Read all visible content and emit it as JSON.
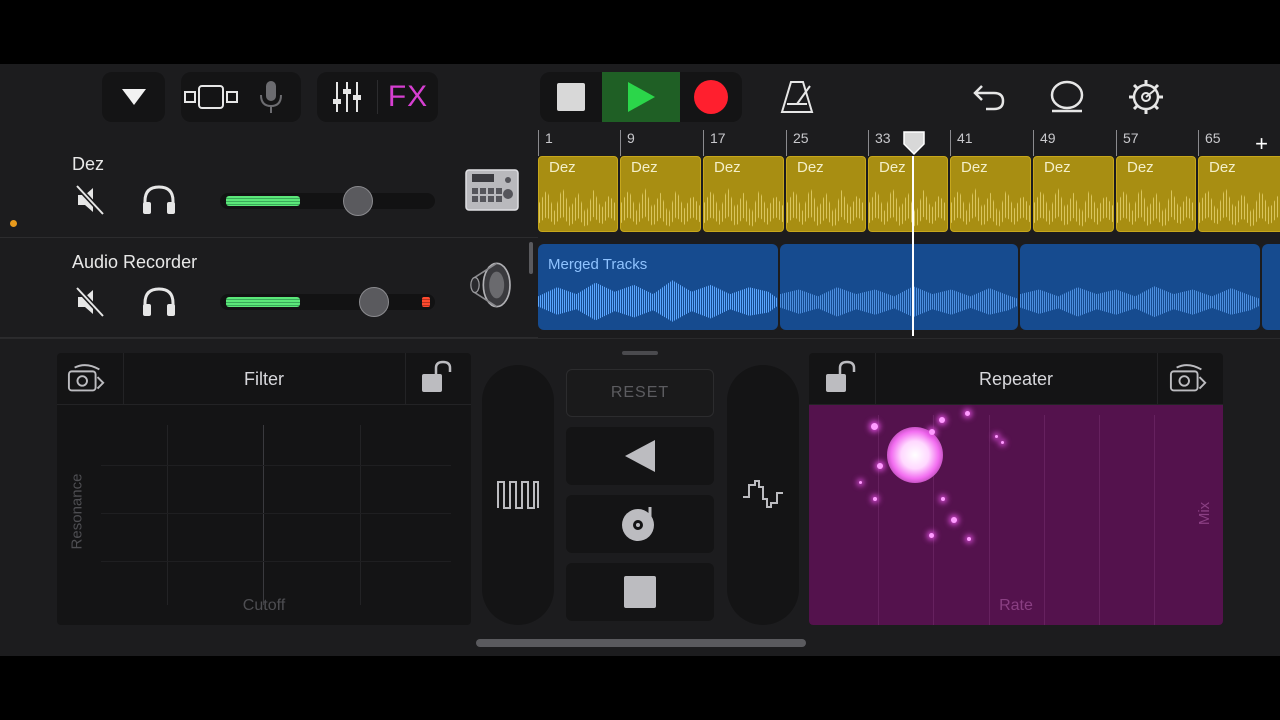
{
  "toolbar": {
    "fx_label": "FX",
    "icons": [
      "dropdown-triangle-icon",
      "track-view-icon",
      "microphone-icon",
      "mixer-sliders-icon",
      "fx",
      "stop-icon",
      "play-icon",
      "record-icon",
      "metronome-icon",
      "undo-icon",
      "loop-icon",
      "settings-gear-icon"
    ]
  },
  "ruler": {
    "bars": [
      "1",
      "9",
      "17",
      "25",
      "33",
      "41",
      "49",
      "57",
      "65"
    ],
    "add_label": "+"
  },
  "tracks": [
    {
      "name": "Dez",
      "muted": true,
      "volume_level": 0.6,
      "instrument_icon": "drum-machine-icon",
      "region_label": "Dez",
      "region_color": "#a88e12"
    },
    {
      "name": "Audio Recorder",
      "muted": true,
      "volume_level": 0.72,
      "instrument_icon": "speaker-icon",
      "region_label": "Merged Tracks",
      "region_color": "#164b8f"
    }
  ],
  "remix": {
    "left_pad": {
      "title": "Filter",
      "x_axis": "Cutoff",
      "y_axis": "Resonance"
    },
    "right_pad": {
      "title": "Repeater",
      "x_axis": "Rate",
      "y_axis": "Mix",
      "color": "#54124d"
    },
    "reset_label": "RESET",
    "center_icons": [
      "reverse-icon",
      "turntable-scratch-icon",
      "tape-stop-icon"
    ],
    "gate_icon": "square-wave-icon",
    "downsampler_icon": "sine-wave-icon"
  },
  "colors": {
    "accent_fx": "#d63fd1",
    "play": "#2bd64a",
    "record": "#ff1f2e",
    "volume": "#5be879"
  }
}
